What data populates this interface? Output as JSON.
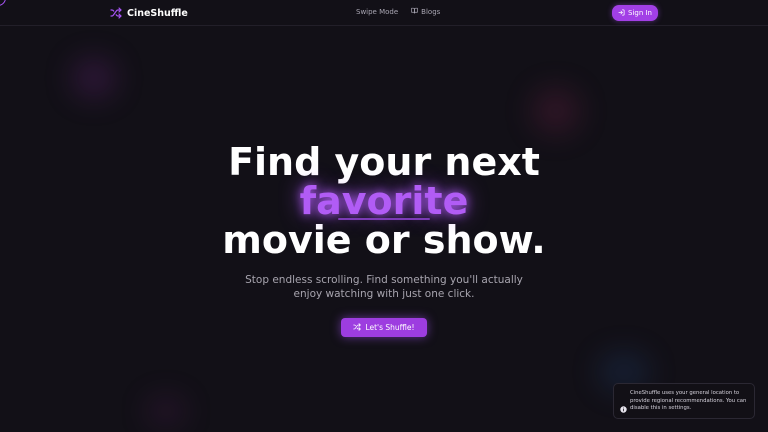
{
  "header": {
    "brand_name": "CineShuffle",
    "nav": [
      {
        "label": "Swipe Mode",
        "icon": "none"
      },
      {
        "label": "Blogs",
        "icon": "book-icon"
      }
    ],
    "sign_in_label": "Sign In"
  },
  "hero": {
    "line1": "Find your next",
    "highlight": "favorite",
    "line3": "movie or show.",
    "subtitle": "Stop endless scrolling. Find something you'll actually enjoy watching with just one click.",
    "cta_label": "Let's Shuffle!"
  },
  "toast": {
    "icon": "info-icon",
    "message": "CineShuffle uses your general location to provide regional recommendations. You can disable this in settings."
  },
  "colors": {
    "background": "#121017",
    "accent": "#a855f7",
    "button": "#a23fe6",
    "muted_text": "#a7a4ae"
  }
}
